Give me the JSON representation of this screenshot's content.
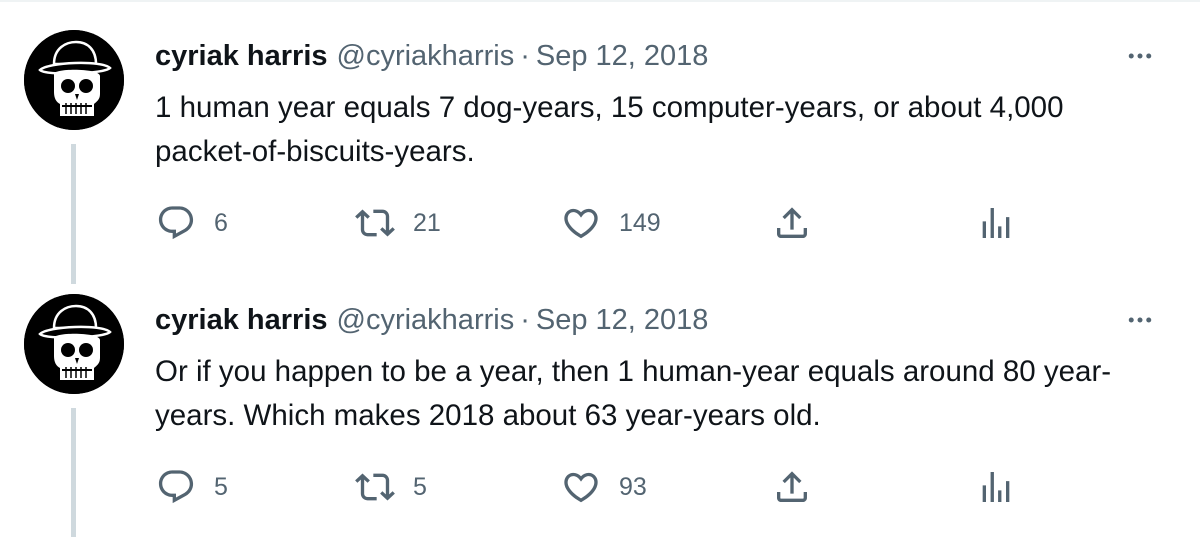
{
  "tweets": [
    {
      "author": {
        "name": "cyriak harris",
        "handle": "@cyriakharris",
        "avatar_icon": "skull-bowler-hat-avatar"
      },
      "separator": "·",
      "date": "Sep 12, 2018",
      "text": "1 human year equals 7 dog-years, 15 computer-years, or about 4,000 packet-of-biscuits-years.",
      "replies": "6",
      "retweets": "21",
      "likes": "149"
    },
    {
      "author": {
        "name": "cyriak harris",
        "handle": "@cyriakharris",
        "avatar_icon": "skull-bowler-hat-avatar"
      },
      "separator": "·",
      "date": "Sep 12, 2018",
      "text": "Or if you happen to be a year, then 1 human-year equals around 80 year-years. Which makes 2018 about 63 year-years old.",
      "replies": "5",
      "retweets": "5",
      "likes": "93"
    }
  ],
  "icons": {
    "more": "more-icon",
    "reply": "reply-icon",
    "retweet": "retweet-icon",
    "like": "heart-icon",
    "share": "share-icon",
    "stats": "stats-icon"
  },
  "colors": {
    "text": "#0f1419",
    "secondary": "#536471",
    "thread_line": "#cfd9de",
    "avatar_bg": "#000000"
  }
}
